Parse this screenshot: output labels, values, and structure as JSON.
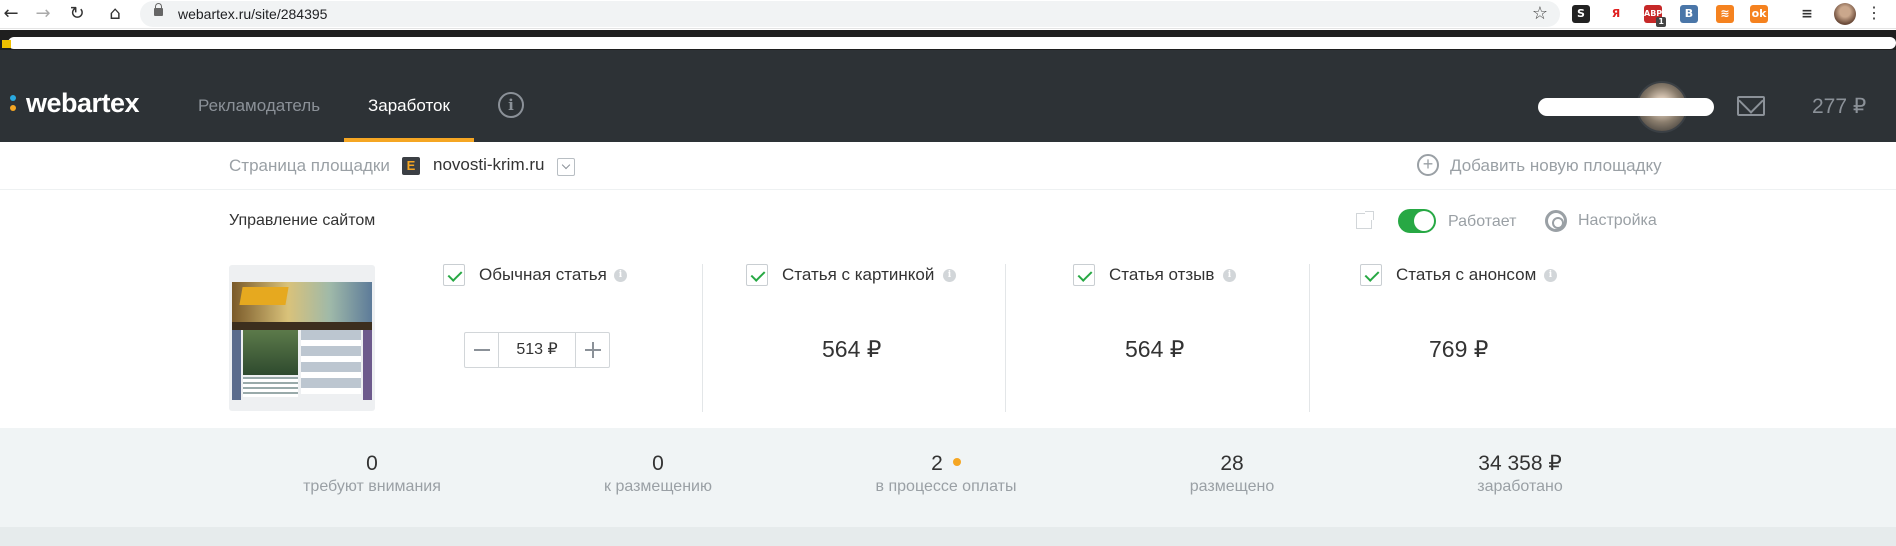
{
  "browser": {
    "url": "webartex.ru/site/284395",
    "ext_badge": "1"
  },
  "header": {
    "logo": "webartex",
    "nav": [
      "Рекламодатель",
      "Заработок"
    ],
    "balance": "277 ₽",
    "colors": {
      "background": "#2d3236",
      "accent": "#f5a623",
      "inactive": "#8b9198"
    }
  },
  "site_selector": {
    "label": "Страница площадки",
    "site_icon_letter": "E",
    "site_name": "novosti-krim.ru",
    "add_site": "Добавить новую площадку"
  },
  "management": {
    "title": "Управление сайтом",
    "status": "Работает",
    "settings": "Настройка"
  },
  "article_types": [
    {
      "label": "Обычная статья",
      "price": "513 ₽",
      "checked": true
    },
    {
      "label": "Статья с картинкой",
      "price": "564 ₽",
      "checked": true
    },
    {
      "label": "Статья отзыв",
      "price": "564 ₽",
      "checked": true
    },
    {
      "label": "Статья с анонсом",
      "price": "769 ₽",
      "checked": true
    }
  ],
  "stats": [
    {
      "value": "0",
      "label": "требуют внимания"
    },
    {
      "value": "0",
      "label": "к размещению"
    },
    {
      "value": "2",
      "label": "в процессе оплаты"
    },
    {
      "value": "28",
      "label": "размещено"
    },
    {
      "value": "34 358 ₽",
      "label": "заработано"
    }
  ]
}
